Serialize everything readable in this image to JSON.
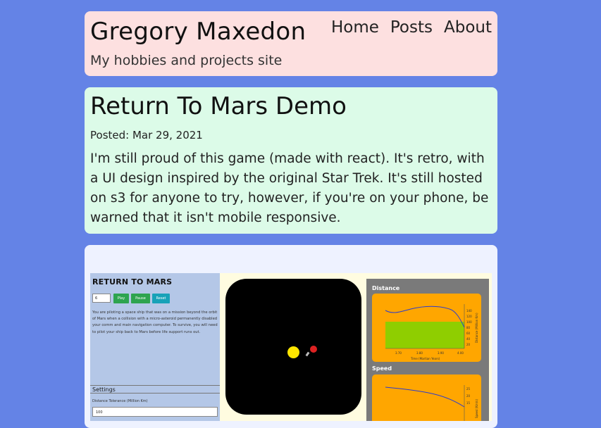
{
  "site": {
    "title": "Gregory Maxedon",
    "tagline": "My hobbies and projects site",
    "nav": [
      "Home",
      "Posts",
      "About"
    ]
  },
  "post": {
    "title": "Return To Mars Demo",
    "date": "Posted: Mar 29, 2021",
    "body": "I'm still proud of this game (made with react). It's retro, with a UI design inspired by the original Star Trek. It's still hosted on s3 for anyone to try, however, if you're on your phone, be warned that it isn't mobile responsive."
  },
  "screenshot": {
    "game_title": "RETURN TO MARS",
    "input_value": "6",
    "buttons": [
      {
        "label": "Play",
        "color": "#2ea44f"
      },
      {
        "label": "Pause",
        "color": "#2ea44f"
      },
      {
        "label": "Reset",
        "color": "#17a2b8"
      }
    ],
    "description": "You are piloting a space ship that was on a mission beyond the orbit of Mars when a collision with a micro-asteroid permanently disabled your comm and main navigation computer. To survive, you will need to pilot your ship back to Mars before life support runs out.",
    "settings_header": "Settings",
    "tolerance_label": "Distance Tolerance (Million Km)",
    "tolerance_value": "100",
    "chart_titles": [
      "Distance",
      "Speed"
    ],
    "distance_chart": {
      "x_ticks": [
        "3.70",
        "3.80",
        "3.90",
        "4.00"
      ],
      "y_ticks": [
        "140",
        "120",
        "100",
        "80",
        "60",
        "40",
        "20"
      ],
      "xlabel": "Time (Martian Years)",
      "ylabel": "Distance (Million Km)"
    },
    "speed_chart": {
      "y_ticks": [
        "25",
        "20",
        "15"
      ],
      "ylabel": "Speed (Km/s)"
    }
  }
}
